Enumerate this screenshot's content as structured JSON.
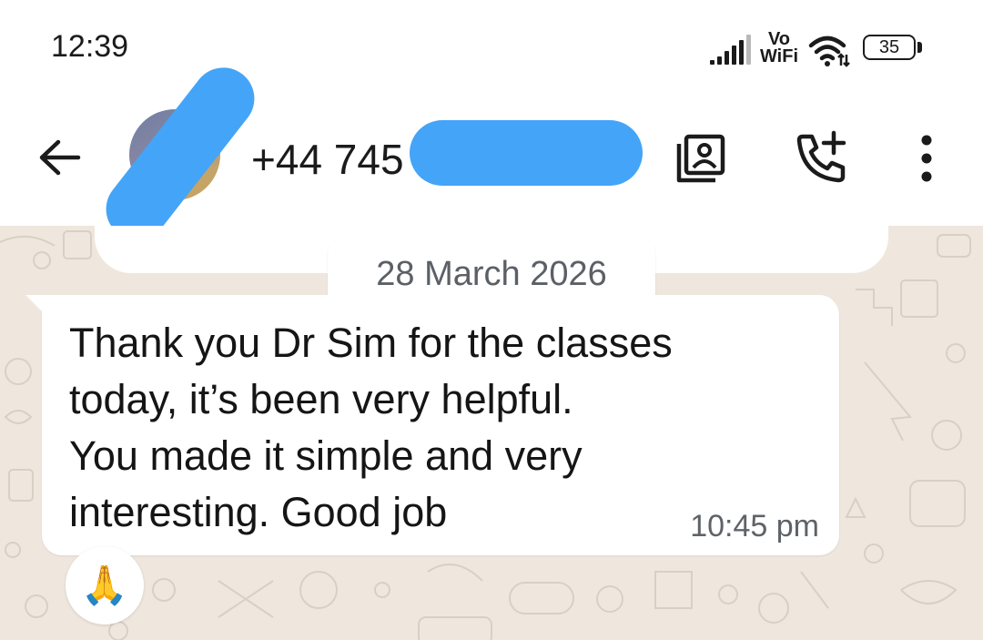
{
  "status_bar": {
    "time": "12:39",
    "network_line1": "Vo",
    "network_line2": "WiFi",
    "battery": "35",
    "icons": [
      "signal-icon",
      "wifi-icon",
      "battery-icon"
    ]
  },
  "header": {
    "contact_visible": "+44 745",
    "icons": [
      "back-arrow-icon",
      "contact-card-icon",
      "add-call-icon",
      "more-vertical-icon"
    ]
  },
  "chat": {
    "date_chip": "28 March 2026",
    "message": {
      "lines": [
        "Thank you Dr Sim for the classes",
        "today, it’s been very helpful.",
        "You made it simple and very",
        "interesting. Good job"
      ],
      "time": "10:45 pm",
      "reaction": "🙏"
    }
  },
  "colors": {
    "chat_background": "#efe7de",
    "bubble": "#ffffff",
    "redaction": "#44a4f7",
    "text": "#151515",
    "meta_text": "#5f6368"
  }
}
